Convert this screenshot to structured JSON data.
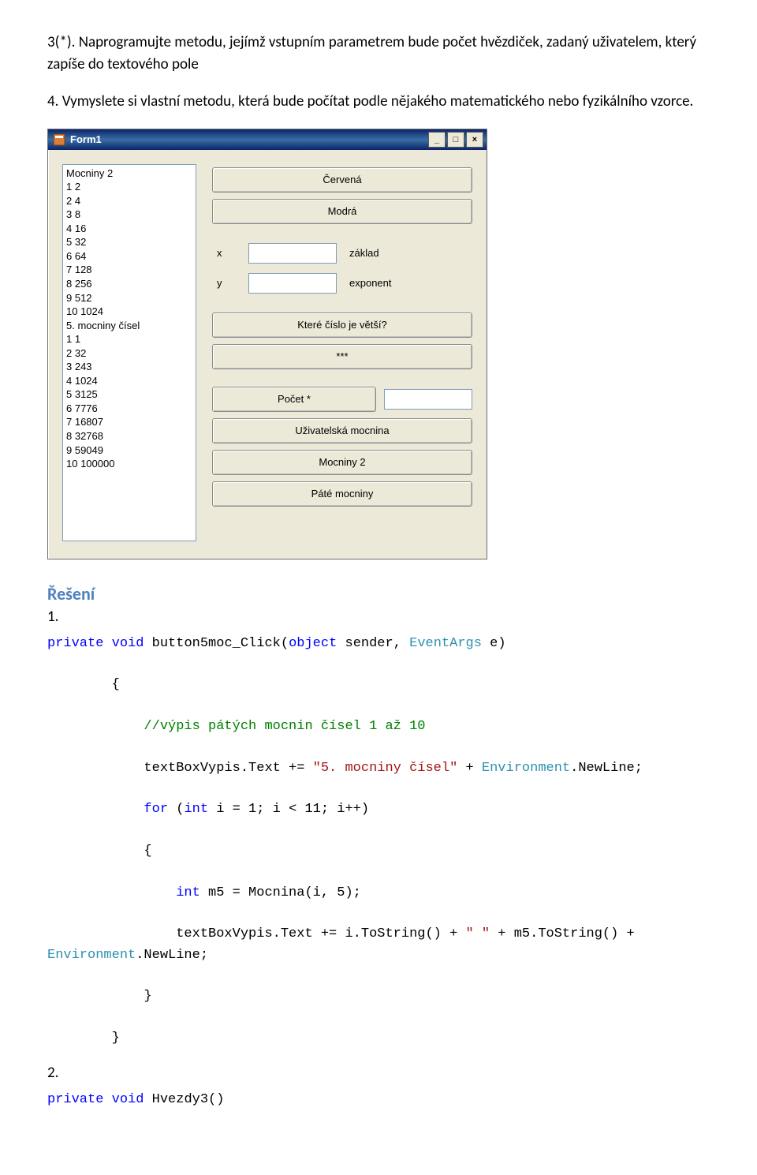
{
  "intro": {
    "line1": "3(*). Naprogramujte metodu, jejímž vstupním parametrem bude počet hvězdiček, zadaný uživatelem, který zapíše do textového pole",
    "line2": "4. Vymyslete si vlastní metodu, která bude počítat podle nějakého matematického nebo fyzikálního vzorce."
  },
  "form": {
    "title": "Form1",
    "win_buttons": {
      "min": "_",
      "max": "□",
      "close": "×"
    },
    "listbox_lines": "Mocniny 2\n1 2\n2 4\n3 8\n4 16\n5 32\n6 64\n7 128\n8 256\n9 512\n10 1024\n5. mocniny čísel\n1 1\n2 32\n3 243\n4 1024\n5 3125\n6 7776\n7 16807\n8 32768\n9 59049\n10 100000",
    "buttons": {
      "cervena": "Červená",
      "modra": "Modrá",
      "vetsi": "Které číslo je větší?",
      "stars": "***",
      "pocet": "Počet *",
      "user_pow": "Uživatelská mocnina",
      "moc2": "Mocniny 2",
      "pate": "Páté mocniny"
    },
    "labels": {
      "x": "x",
      "y": "y",
      "zaklad": "základ",
      "exponent": "exponent"
    }
  },
  "solution": {
    "heading": "Řešení",
    "item1": "1.",
    "item2": "2."
  },
  "code1": {
    "l1a": "private",
    "l1b": " ",
    "l1c": "void",
    "l1d": " button5moc_Click(",
    "l1e": "object",
    "l1f": " sender, ",
    "l1g": "EventArgs",
    "l1h": " e)",
    "l2": "        {",
    "l3": "            //výpis pátých mocnin čísel 1 až 10",
    "l4a": "            textBoxVypis.Text += ",
    "l4b": "\"5. mocniny čísel\"",
    "l4c": " + ",
    "l4d": "Environment",
    "l4e": ".NewLine;",
    "l5a": "            ",
    "l5b": "for",
    "l5c": " (",
    "l5d": "int",
    "l5e": " i = 1; i < 11; i++)",
    "l6": "            {",
    "l7a": "                ",
    "l7b": "int",
    "l7c": " m5 = Mocnina(i, 5);",
    "l8a": "                textBoxVypis.Text += i.ToString() + ",
    "l8b": "\" \"",
    "l8c": " + m5.ToString() + ",
    "l8d": "Environment",
    "l8e": ".NewLine;",
    "l9": "            }",
    "l10": "        }"
  },
  "code2": {
    "l1a": "private",
    "l1b": " ",
    "l1c": "void",
    "l1d": " Hvezdy3()"
  }
}
